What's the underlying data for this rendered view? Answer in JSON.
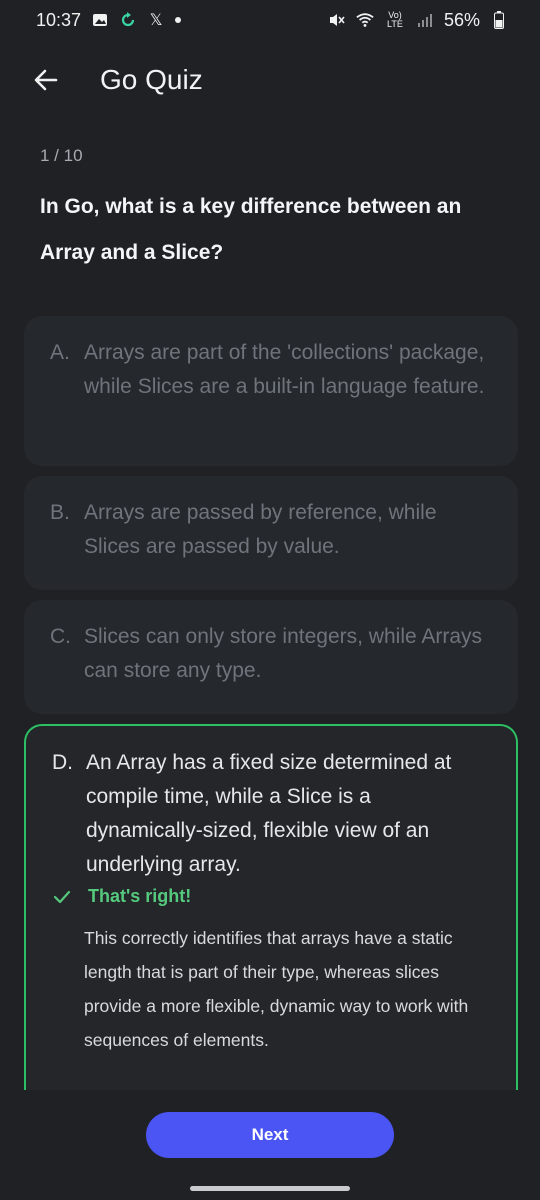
{
  "status_bar": {
    "time": "10:37",
    "left_icons": [
      "image-icon",
      "sync-icon",
      "x-logo-icon",
      "dot-icon"
    ],
    "right_icons": [
      "mute-icon",
      "wifi-icon",
      "volte-icon",
      "signal-icon",
      "battery-icon"
    ],
    "x_logo": "𝕏",
    "volte": "Vo) LTE",
    "battery": "56%"
  },
  "app_bar": {
    "title": "Go Quiz",
    "back_icon": "arrow-left-icon"
  },
  "quiz": {
    "progress": "1 / 10",
    "question": "In Go, what is a key difference between an Array and a Slice?",
    "options": [
      {
        "letter": "A.",
        "text": "Arrays are part of the 'collections' package, while Slices are a built-in language feature.",
        "state": "disabled"
      },
      {
        "letter": "B.",
        "text": "Arrays are passed by reference, while Slices are passed by value.",
        "state": "disabled"
      },
      {
        "letter": "C.",
        "text": "Slices can only store integers, while Arrays can store any type.",
        "state": "disabled"
      },
      {
        "letter": "D.",
        "text": "An Array has a fixed size determined at compile time, while a Slice is a dynamically-sized, flexible view of an underlying array.",
        "state": "correct"
      }
    ],
    "feedback": {
      "title": "That's right!",
      "icon": "check-icon",
      "explanation": "This correctly identifies that arrays have a static length that is part of their type, whereas slices provide a more flexible, dynamic way to work with sequences of elements."
    }
  },
  "footer": {
    "next_label": "Next"
  },
  "colors": {
    "background": "#1f2125",
    "correct": "#2dbf63",
    "correct_text": "#55c97d",
    "primary_button": "#4b55f4"
  }
}
